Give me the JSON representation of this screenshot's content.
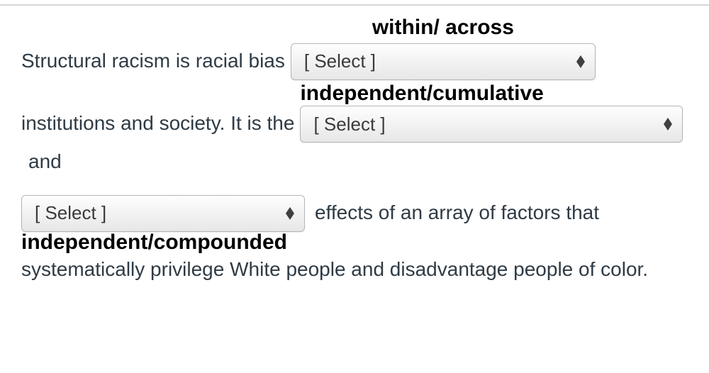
{
  "dropdown_placeholder": "[ Select ]",
  "sentence": {
    "part1": "Structural racism is racial bias",
    "part2": "institutions and society. It is the",
    "part3": "and",
    "part4": "effects of an array of factors that",
    "part5": "systematically privilege White people and disadvantage people of color."
  },
  "annotations": {
    "blank1": "within/ across",
    "blank2": "independent/cumulative",
    "blank3": "independent/compounded"
  }
}
